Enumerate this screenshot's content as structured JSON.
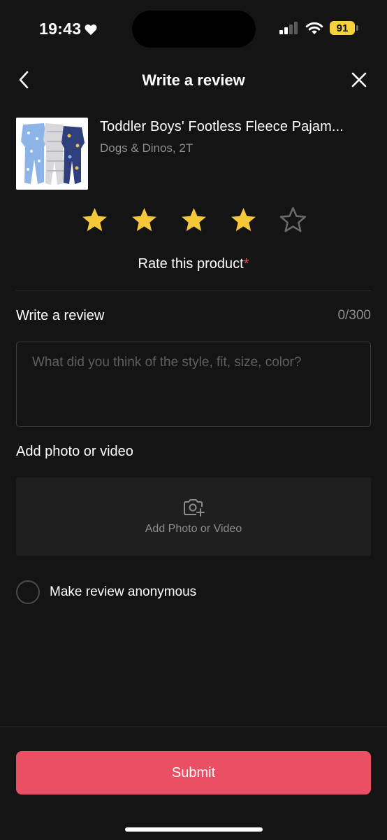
{
  "status_bar": {
    "time": "19:43",
    "battery": "91",
    "icons": [
      "heart-icon",
      "cellular-signal-icon",
      "wifi-icon",
      "battery-icon"
    ]
  },
  "header": {
    "title": "Write a review",
    "back_icon": "chevron-left-icon",
    "close_icon": "close-icon"
  },
  "product": {
    "name": "Toddler Boys' Footless Fleece Pajam...",
    "variant": "Dogs & Dinos, 2T",
    "image_icon": "product-pajamas-image"
  },
  "rating": {
    "selected": 4,
    "max": 5,
    "label": "Rate this product",
    "required_mark": "*",
    "colors": {
      "filled": "#f5c83a",
      "empty": "#6a6a6a"
    }
  },
  "review": {
    "title": "Write a review",
    "counter": "0/300",
    "placeholder": "What did you think of the style, fit, size, color?",
    "value": ""
  },
  "media": {
    "title": "Add photo or video",
    "button_label": "Add Photo or Video",
    "icon": "camera-plus-icon"
  },
  "anonymous": {
    "label": "Make review anonymous",
    "checked": false
  },
  "submit": {
    "label": "Submit",
    "color": "#ea4f64"
  }
}
